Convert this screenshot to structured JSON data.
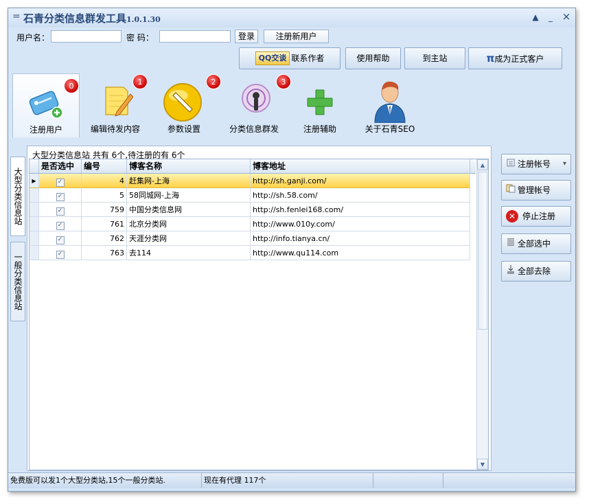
{
  "window": {
    "title": "石青分类信息群发工具",
    "version": "1.0.1.30",
    "controls": {
      "menu_glyph": "=",
      "up_glyph": "▲",
      "minimize_glyph": "_",
      "close_glyph": "×"
    }
  },
  "login": {
    "username_label": "用户名：",
    "username_value": "",
    "password_label": "密  码：",
    "password_value": "",
    "login_button": "登录",
    "register_button": "注册新用户"
  },
  "top_buttons": {
    "qq_badge": "QQ交谈",
    "contact": "联系作者",
    "help": "使用帮助",
    "homepage": "到主站",
    "pi_glyph": "π",
    "become_customer": "成为正式客户"
  },
  "toolbar": [
    {
      "label": "注册用户",
      "badge": "0",
      "icon": "tag-add-icon",
      "active": true
    },
    {
      "label": "编辑待发内容",
      "badge": "1",
      "icon": "note-pencil-icon"
    },
    {
      "label": "参数设置",
      "badge": "2",
      "icon": "wrench-icon"
    },
    {
      "label": "分类信息群发",
      "badge": "3",
      "icon": "broadcast-icon"
    },
    {
      "label": "注册辅助",
      "icon": "plus-icon"
    },
    {
      "label": "关于石青SEO",
      "icon": "user-avatar-icon"
    }
  ],
  "vertical_tabs": [
    {
      "label": "大型分类信息站",
      "active": true
    },
    {
      "label": "一般分类信息站",
      "active": false
    }
  ],
  "group_title": "大型分类信息站 共有 6个,待注册的有 6个",
  "grid": {
    "columns": [
      "是否选中",
      "编号",
      "博客名称",
      "博客地址"
    ],
    "check_glyph": "✓",
    "current_row_glyph": "▶",
    "rows": [
      {
        "checked": true,
        "id": "4",
        "name": "赶集网-上海",
        "url": "http://sh.ganji.com/",
        "selected": true
      },
      {
        "checked": true,
        "id": "5",
        "name": "58同城网-上海",
        "url": "http://sh.58.com/"
      },
      {
        "checked": true,
        "id": "759",
        "name": "中国分类信息网",
        "url": "http://sh.fenlei168.com/"
      },
      {
        "checked": true,
        "id": "761",
        "name": "北京分类网",
        "url": "http://www.010y.com/"
      },
      {
        "checked": true,
        "id": "762",
        "name": "天涯分类网",
        "url": "http://info.tianya.cn/"
      },
      {
        "checked": true,
        "id": "763",
        "name": "去114",
        "url": "http://www.qu114.com"
      }
    ]
  },
  "scrollbar": {
    "up_glyph": "▲",
    "down_glyph": "▼"
  },
  "side_buttons": {
    "register_account": "注册帐号",
    "register_account_icon": "list-icon",
    "dropdown_glyph": "▾",
    "manage_account": "管理帐号",
    "manage_account_icon": "manage-icon",
    "stop_register": "停止注册",
    "stop_glyph": "✕",
    "select_all": "全部选中",
    "select_all_icon": "select-all-icon",
    "remove_all": "全部去除",
    "remove_all_icon": "remove-all-icon"
  },
  "status": {
    "free_version": "免费版可以发1个大型分类站,15个一般分类站.",
    "proxy_count": "现在有代理 117个"
  },
  "colors": {
    "selected_row": "#ffd24a",
    "badge_red": "#d10f0f",
    "window_bg": "#d7e6f7"
  }
}
